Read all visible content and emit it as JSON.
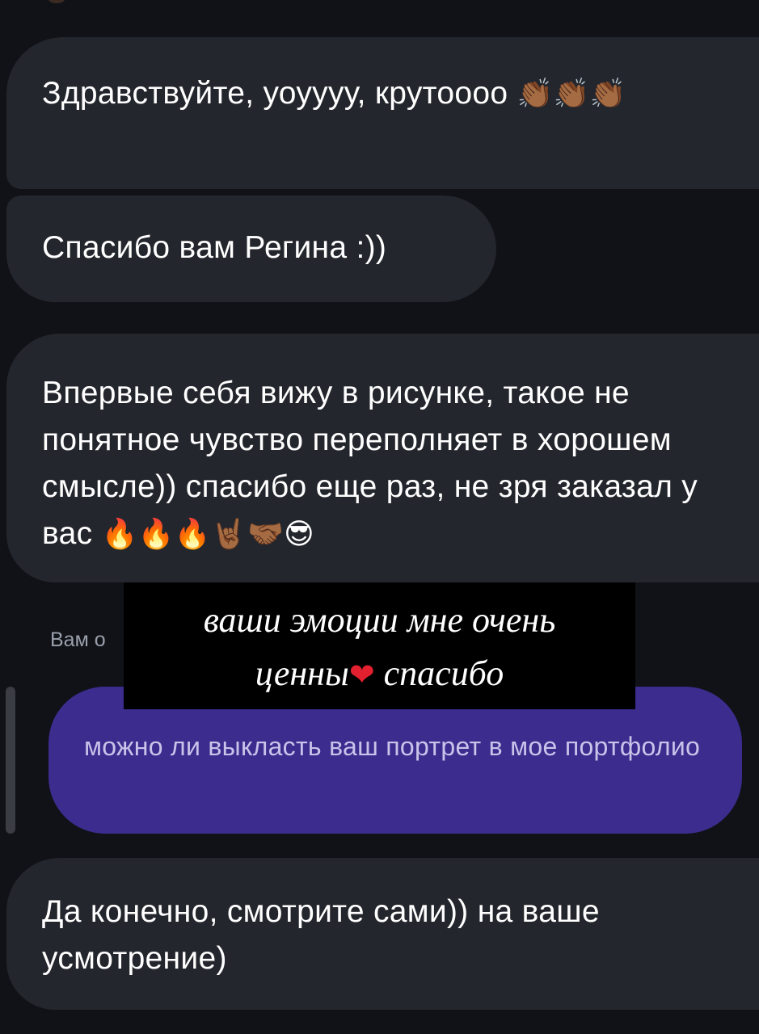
{
  "messages": [
    {
      "id": "m1",
      "direction": "incoming",
      "text": "Здравствуйте, уоуууу, крутоооо",
      "emoji": "👏🏾👏🏾👏🏾"
    },
    {
      "id": "m2",
      "direction": "incoming",
      "text": "Спасибо вам Регина :))"
    },
    {
      "id": "m3",
      "direction": "incoming",
      "text": "Впервые себя вижу в рисунке, такое не понятное чувство переполняет в хорошем смысле)) спасибо еще раз, не зря заказал у вас",
      "emoji": "🔥🔥🔥🤘🏾🤝🏾😎"
    },
    {
      "id": "m5",
      "direction": "incoming",
      "text": "Да конечно, смотрите сами)) на ваше усмотрение)"
    }
  ],
  "reply": {
    "label": "Вам о",
    "outgoing_text": "можно ли выкласть ваш портрет в мое портфолио"
  },
  "story_caption": {
    "line1": "ваши эмоции мне очень",
    "line2_before": "ценны",
    "heart": "❤",
    "line2_after": " спасибо"
  },
  "colors": {
    "background": "#101217",
    "incoming_bubble": "#24262d",
    "outgoing_bubble": "#3b2c8e",
    "caption_box": "#000000"
  }
}
